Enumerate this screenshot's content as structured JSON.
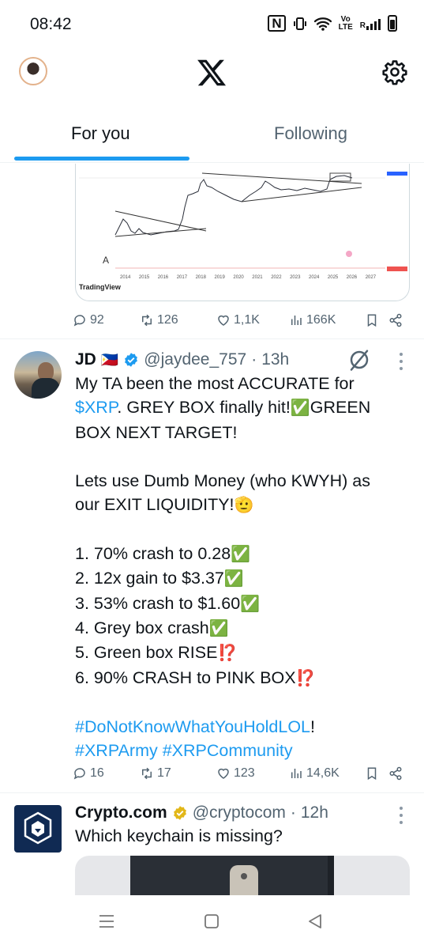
{
  "status_bar": {
    "time": "08:42",
    "nfc_label": "N",
    "volte_label_1": "Vo",
    "volte_label_2": "LTE",
    "roaming_label": "R"
  },
  "header": {
    "logo": "x-logo-icon",
    "settings": "gear-icon"
  },
  "tabs": [
    {
      "label": "For you",
      "active": true
    },
    {
      "label": "Following",
      "active": false
    }
  ],
  "prev_tweet": {
    "chart_source": "TradingView",
    "chart_years": [
      "2014",
      "2015",
      "2016",
      "2017",
      "2018",
      "2019",
      "2020",
      "2021",
      "2022",
      "2023",
      "2024",
      "2025",
      "2026",
      "2027"
    ],
    "actions": {
      "replies": "92",
      "reposts": "126",
      "likes": "1,1K",
      "views": "166K"
    }
  },
  "tweet": {
    "name": "JD",
    "flag": "🇵🇭",
    "handle": "@jaydee_757",
    "separator": "·",
    "time": "13h",
    "lines": {
      "l1": "My TA been the most ACCURATE for",
      "l2_link": "$XRP",
      "l2_rest": ". GREY BOX finally hit!",
      "l2_emoji": "✅",
      "l2_end": "GREEN",
      "l3": "BOX NEXT TARGET!",
      "l4": "Lets use Dumb Money (who KWYH) as",
      "l5": "our EXIT LIQUIDITY!",
      "l5_emoji": "🫡",
      "item1": "1. 70% crash to 0.28",
      "item2": "2. 12x gain to $3.37",
      "item3": "3. 53% crash to $1.60",
      "item4": "4. Grey box crash",
      "item5": "5. Green box RISE",
      "item6": "6. 90% CRASH to PINK BOX",
      "check": "✅",
      "interrobang": "⁉️",
      "hashtag1": "#DoNotKnowWhatYouHoldLOL",
      "hashtag1_end": "!",
      "hashtag2": "#XRPArmy",
      "hashtag3": "#XRPCommunity"
    },
    "actions": {
      "replies": "16",
      "reposts": "17",
      "likes": "123",
      "views": "14,6K"
    }
  },
  "next_tweet": {
    "name": "Crypto.com",
    "handle": "@cryptocom",
    "separator": "·",
    "time": "12h",
    "text": "Which keychain is missing?"
  }
}
